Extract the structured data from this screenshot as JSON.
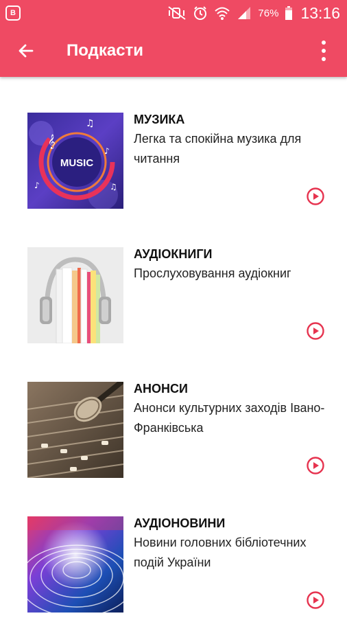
{
  "status_bar": {
    "left_icon": "vk-icon",
    "battery_percent": "76%",
    "time": "13:16"
  },
  "app_bar": {
    "title": "Подкасти",
    "back_icon": "arrow-left-icon",
    "menu_icon": "more-vert-icon"
  },
  "colors": {
    "accent": "#ef4a63",
    "play": "#e6334f"
  },
  "podcasts": [
    {
      "title": "МУЗИКА",
      "description": "Легка та спокійна музика для читання",
      "thumb_label": "MUSIC"
    },
    {
      "title": "АУДІОКНИГИ",
      "description": "Прослуховування аудіокниг"
    },
    {
      "title": "АНОНСИ",
      "description": "Анонси культурних заходів Івано-Франківська"
    },
    {
      "title": "АУДІОНОВИНИ",
      "description": "Новини головних бібліотечних подій України"
    }
  ]
}
